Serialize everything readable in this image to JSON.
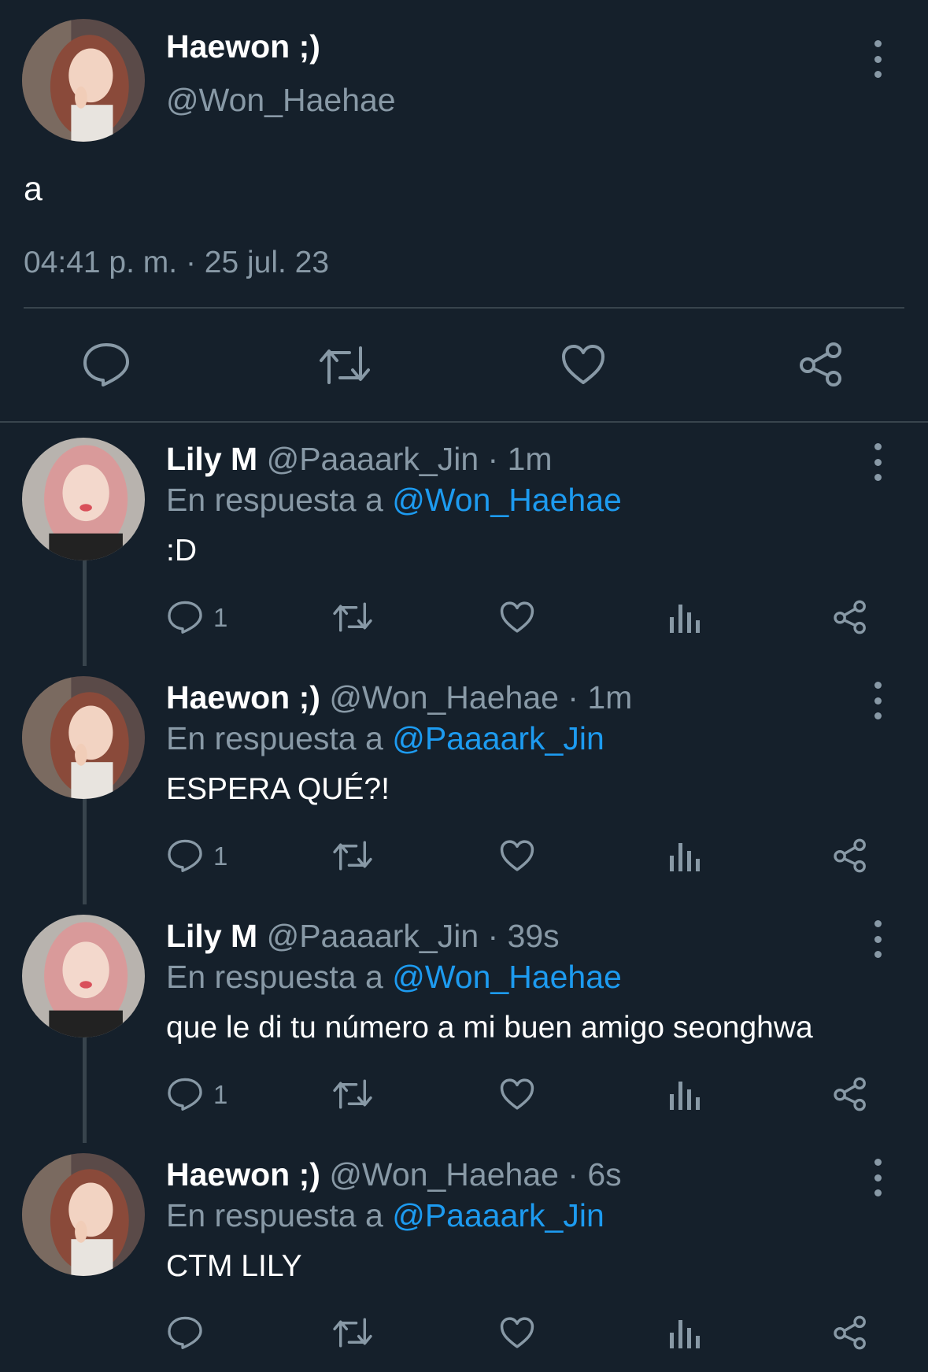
{
  "main_tweet": {
    "name": "Haewon ;)",
    "handle": "@Won_Haehae",
    "text": "a",
    "timestamp": "04:41 p. m. · 25 jul. 23",
    "actions": [
      "reply-icon",
      "retweet-icon",
      "like-icon",
      "share-icon"
    ]
  },
  "replies": [
    {
      "name": "Lily M",
      "meta": "@Paaaark_Jin · 1m",
      "reply_prefix": "En respuesta a",
      "mention": "@Won_Haehae",
      "text": ":D",
      "reply_count": "1"
    },
    {
      "name": "Haewon ;)",
      "meta": "@Won_Haehae · 1m",
      "reply_prefix": "En respuesta a",
      "mention": "@Paaaark_Jin",
      "text": "ESPERA QUÉ?!",
      "reply_count": "1"
    },
    {
      "name": "Lily M",
      "meta": "@Paaaark_Jin · 39s",
      "reply_prefix": "En respuesta a",
      "mention": "@Won_Haehae",
      "text": "que le di tu número a mi buen amigo seonghwa",
      "reply_count": "1"
    },
    {
      "name": "Haewon ;)",
      "meta": "@Won_Haehae · 6s",
      "reply_prefix": "En respuesta a",
      "mention": "@Paaaark_Jin",
      "text": "CTM LILY",
      "reply_count": ""
    }
  ],
  "colors": {
    "background": "#15202b",
    "muted_text": "#8899a6",
    "mention": "#1d9bf0",
    "divider": "#38444d"
  }
}
